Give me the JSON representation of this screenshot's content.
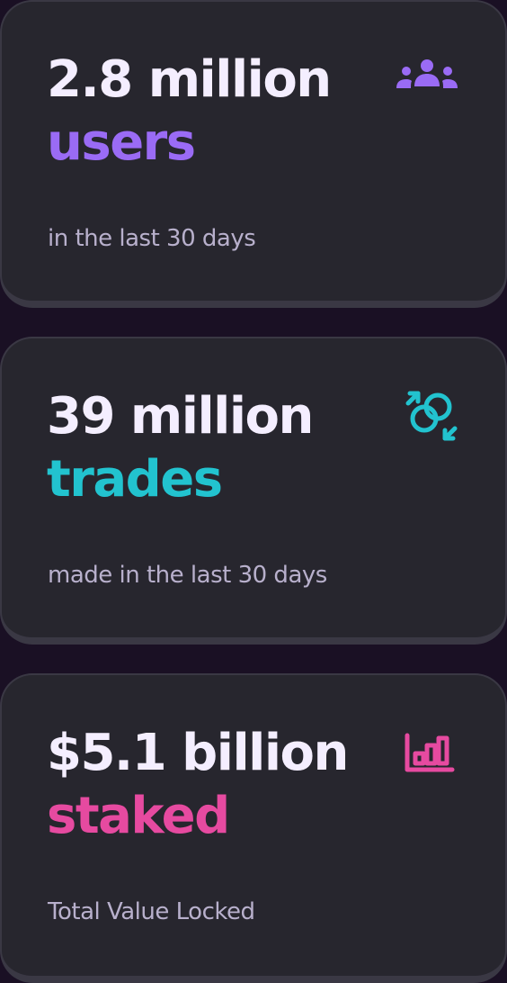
{
  "colors": {
    "background": "#1a1024",
    "card": "#27262e",
    "users_accent": "#9a6bf5",
    "trades_accent": "#22c3cf",
    "staked_accent": "#e64aa0"
  },
  "cards": [
    {
      "value": "2.8 million",
      "label": "users",
      "description": "in the last 30 days",
      "icon": "users-group-icon"
    },
    {
      "value": "39 million",
      "label": "trades",
      "description": "made in the last 30 days",
      "icon": "trade-swap-icon"
    },
    {
      "value": "$5.1 billion",
      "label": "staked",
      "description": "Total Value Locked",
      "icon": "bar-chart-icon"
    }
  ]
}
